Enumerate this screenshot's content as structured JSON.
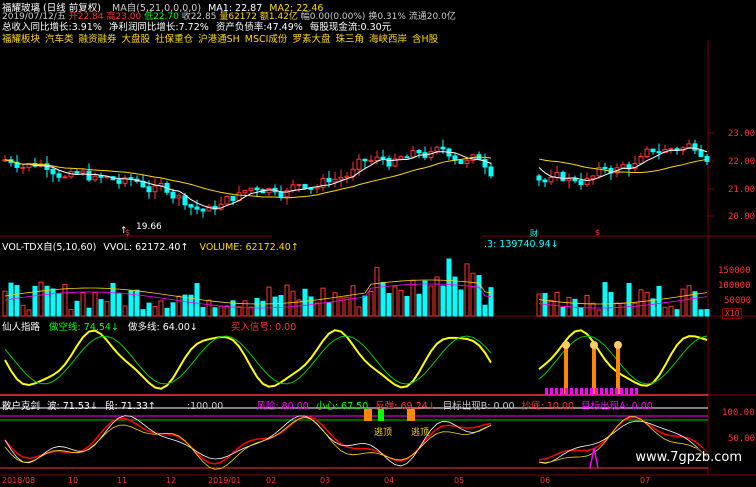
{
  "stock": {
    "name": "福耀玻璃",
    "mode": "(日线 前复权)",
    "ma_label": "MA自(5,21,0,0,0,0)",
    "ma1": "MA1: 22.87",
    "ma2": "MA2: 22.46"
  },
  "quote": {
    "date": "2019/07/12/五",
    "open": "开22.84",
    "high": "高23.00",
    "low": "低22.70",
    "close": "收22.85",
    "volume": "量62172",
    "amount": "额1.42亿",
    "change": "幅0.00(0.00%)",
    "turnover": "换0.31%",
    "float": "流通20.0亿"
  },
  "fundamentals": {
    "revenue_growth": "总收入同比增长:3.91%",
    "profit_growth": "净利润同比增长:7.72%",
    "debt_ratio": "资产负债率:47.49%",
    "cash_per_share": "每股现金流:0.30元"
  },
  "sectors": [
    "福耀板块",
    "汽车类",
    "融资融券",
    "大盘股",
    "社保重仓",
    "沪港通SH",
    "MSCI成份",
    "罗素大盘",
    "珠三角",
    "海峡西岸",
    "含H股"
  ],
  "price_axis": [
    "23.00",
    "22.00",
    "21.00",
    "20.00"
  ],
  "low_marker": "19.66",
  "events": [
    "$",
    "财",
    "$"
  ],
  "vol_panel": {
    "title": "VOL-TDX自(5,10,60)",
    "vvol": "VVOL: 62172.40↑",
    "volume": "VOLUME: 62172.40↑",
    "ma_tail": ".3: 139740.94↓",
    "axis": [
      "150000",
      "100000",
      "50000"
    ],
    "unit": "X10"
  },
  "xz_panel": {
    "title": "仙人指路",
    "empty_line": "做空线: 74.54↓",
    "long_line": "做多线: 64.00↓",
    "buy_signal": "买入信号: 0.00"
  },
  "bottom_panel": {
    "title": "散户克剑",
    "wave": "波: 71.53↓",
    "segment": "段: 71.33↑",
    "level": ":100.00",
    "risk": "风险: 80.00",
    "care": "小心: 67.50",
    "rebound": "反弹: 69.24↓",
    "target_b": "目标出现B: 0.00",
    "bottom_fish": "抄底: 10.00",
    "target_a": "目标出现A: 0.00",
    "escape_top": "逃顶",
    "escape_bottom": "逃顶",
    "axis": [
      "100.00",
      "50.00"
    ]
  },
  "dates": [
    "2018/08",
    "10",
    "11",
    "12",
    "2019/01",
    "02",
    "03",
    "04",
    "05",
    "06",
    "07"
  ],
  "watermark": "www.7gpzb.com",
  "colors": {
    "up": "#ff3333",
    "down": "#00ffff",
    "ma1": "#ffffff",
    "ma2": "#ffd700",
    "grid": "#800000",
    "text_yellow": "#ffd700"
  }
}
